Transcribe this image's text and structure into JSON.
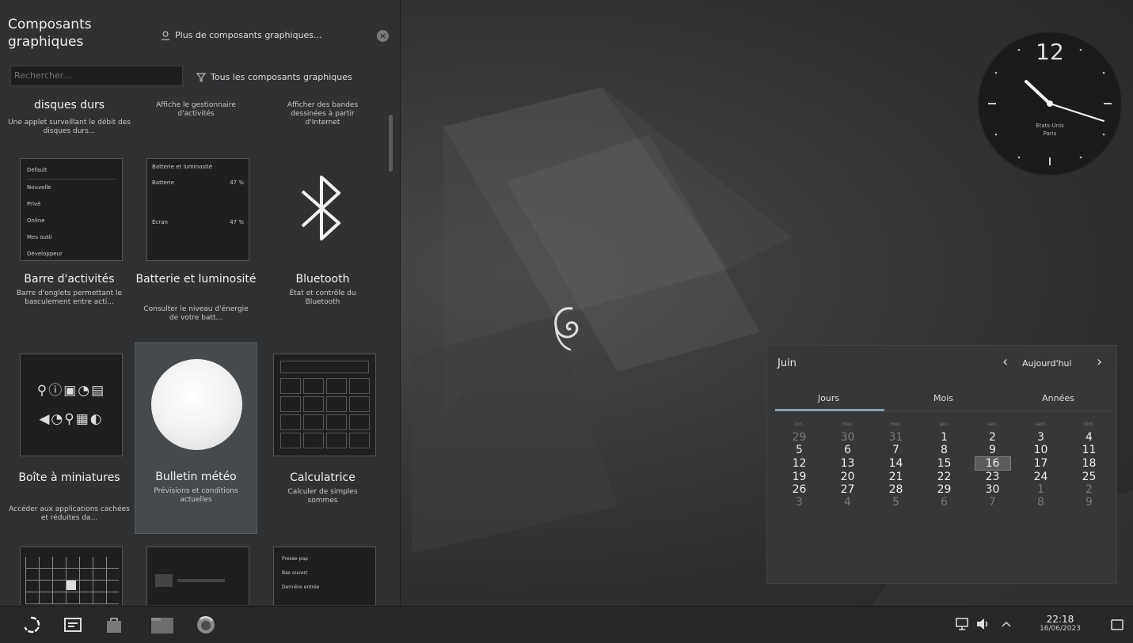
{
  "panel": {
    "title": "Composants graphiques",
    "more_label": "Plus de composants graphiques...",
    "search_placeholder": "Rechercher...",
    "filter_label": "Tous les composants graphiques",
    "widgets": [
      {
        "name": "disques durs",
        "desc": "Une applet surveillant le débit des disques durs..."
      },
      {
        "name": "",
        "desc": "Affiche le gestionnaire d'activités"
      },
      {
        "name": "",
        "desc": "Afficher des bandes dessinées à partir d'Internet"
      },
      {
        "name": "Barre d'activités",
        "desc": "Barre d'onglets permettant le basculement entre acti..."
      },
      {
        "name": "Batterie et luminosité",
        "desc": "Consulter le niveau d'énergie de votre batt..."
      },
      {
        "name": "Bluetooth",
        "desc": "État et contrôle du Bluetooth"
      },
      {
        "name": "Boîte à miniatures",
        "desc": "Accéder aux applications cachées et réduites da..."
      },
      {
        "name": "Bulletin météo",
        "desc": "Prévisions et conditions actuelles"
      },
      {
        "name": "Calculatrice",
        "desc": "Calculer de simples sommes"
      }
    ],
    "activity_thumb": [
      "Default",
      "Nouvelle",
      "Privé",
      "Online",
      "Mes outil",
      "Développeur"
    ],
    "battery_thumb": {
      "header": "Batterie et luminosité",
      "row1": "Batterie",
      "row2": "Écran",
      "pct": "47 %"
    },
    "clipboard_thumb": [
      "Presse-pap",
      "Bas ouvert",
      "Dernière entrée"
    ]
  },
  "clock": {
    "twelve": "12",
    "tz1": "Etats-Unis",
    "tz2": "Paris"
  },
  "calendar": {
    "month": "Juin",
    "today_label": "Aujourd'hui",
    "tabs": [
      "Jours",
      "Mois",
      "Années"
    ],
    "weekday_headers": [
      "lun.",
      "mar.",
      "mer.",
      "jeu.",
      "ven.",
      "sam.",
      "dim."
    ],
    "weeks": [
      [
        {
          "d": "29",
          "dim": true
        },
        {
          "d": "30",
          "dim": true
        },
        {
          "d": "31",
          "dim": true
        },
        {
          "d": "1"
        },
        {
          "d": "2"
        },
        {
          "d": "3"
        },
        {
          "d": "4"
        }
      ],
      [
        {
          "d": "5"
        },
        {
          "d": "6"
        },
        {
          "d": "7"
        },
        {
          "d": "8"
        },
        {
          "d": "9"
        },
        {
          "d": "10"
        },
        {
          "d": "11"
        }
      ],
      [
        {
          "d": "12"
        },
        {
          "d": "13"
        },
        {
          "d": "14"
        },
        {
          "d": "15"
        },
        {
          "d": "16",
          "cur": true
        },
        {
          "d": "17"
        },
        {
          "d": "18"
        }
      ],
      [
        {
          "d": "19"
        },
        {
          "d": "20"
        },
        {
          "d": "21"
        },
        {
          "d": "22"
        },
        {
          "d": "23"
        },
        {
          "d": "24"
        },
        {
          "d": "25"
        }
      ],
      [
        {
          "d": "26"
        },
        {
          "d": "27"
        },
        {
          "d": "28"
        },
        {
          "d": "29"
        },
        {
          "d": "30"
        },
        {
          "d": "1",
          "dim": true
        },
        {
          "d": "2",
          "dim": true
        }
      ],
      [
        {
          "d": "3",
          "dim": true
        },
        {
          "d": "4",
          "dim": true
        },
        {
          "d": "5",
          "dim": true
        },
        {
          "d": "6",
          "dim": true
        },
        {
          "d": "7",
          "dim": true
        },
        {
          "d": "8",
          "dim": true
        },
        {
          "d": "9",
          "dim": true
        }
      ]
    ]
  },
  "taskbar": {
    "time": "22:18",
    "date": "16/06/2023"
  },
  "colors": {
    "panel_bg": "#2f3133",
    "accent": "#8aa0b0",
    "selection": "#474a4d"
  }
}
